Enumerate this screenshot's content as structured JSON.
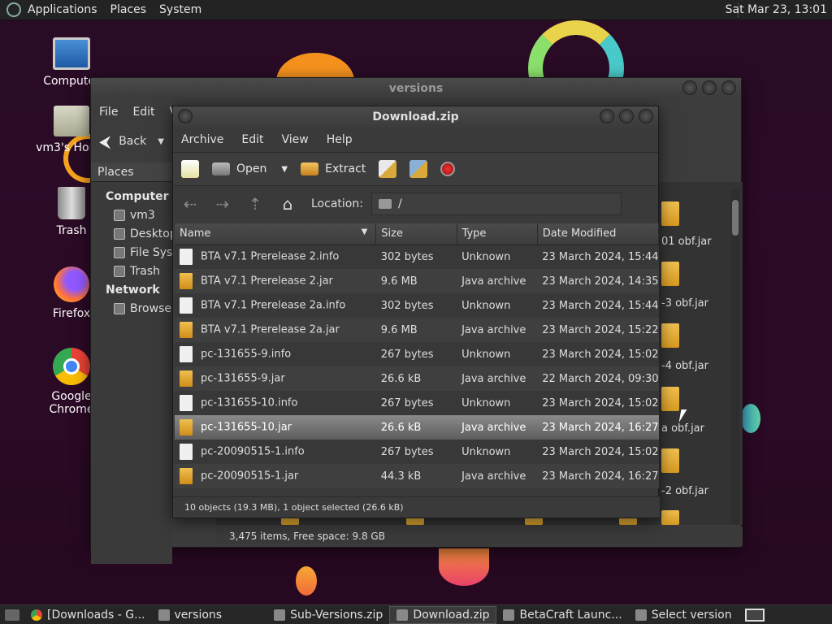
{
  "top_panel": {
    "menus": [
      "Applications",
      "Places",
      "System"
    ],
    "clock": "Sat Mar 23, 13:01"
  },
  "desktop_icons": [
    {
      "label": "Computer"
    },
    {
      "label": "vm3's Home"
    },
    {
      "label": "Trash"
    },
    {
      "label": "Firefox"
    },
    {
      "label": "Google Chrome"
    }
  ],
  "versions_window": {
    "title": "versions",
    "menu": [
      "File",
      "Edit",
      "V"
    ],
    "back_label": "Back",
    "places_label": "Places",
    "sections": {
      "computer": "Computer",
      "network": "Network"
    },
    "computer_items": [
      "vm3",
      "Desktop",
      "File System",
      "Trash"
    ],
    "network_items": [
      "Browse Network"
    ],
    "files": [
      "01 obf.jar",
      "-3 obf.jar",
      "-4 obf.jar",
      "a obf.jar",
      "-2 obf.jar"
    ],
    "status": "3,475 items, Free space: 9.8 GB"
  },
  "download_window": {
    "title": "Download.zip",
    "menu": [
      "Archive",
      "Edit",
      "View",
      "Help"
    ],
    "toolbar": {
      "open": "Open",
      "extract": "Extract"
    },
    "location_label": "Location:",
    "location_path": "/",
    "columns": [
      "Name",
      "Size",
      "Type",
      "Date Modified"
    ],
    "rows": [
      {
        "name": "BTA v7.1 Prerelease 2.info",
        "size": "302 bytes",
        "type": "Unknown",
        "date": "23 March 2024, 15:44",
        "kind": "info"
      },
      {
        "name": "BTA v7.1 Prerelease 2.jar",
        "size": "9.6 MB",
        "type": "Java archive",
        "date": "23 March 2024, 14:35",
        "kind": "jar"
      },
      {
        "name": "BTA v7.1 Prerelease 2a.info",
        "size": "302 bytes",
        "type": "Unknown",
        "date": "23 March 2024, 15:44",
        "kind": "info"
      },
      {
        "name": "BTA v7.1 Prerelease 2a.jar",
        "size": "9.6 MB",
        "type": "Java archive",
        "date": "23 March 2024, 15:22",
        "kind": "jar"
      },
      {
        "name": "pc-131655-9.info",
        "size": "267 bytes",
        "type": "Unknown",
        "date": "23 March 2024, 15:02",
        "kind": "info"
      },
      {
        "name": "pc-131655-9.jar",
        "size": "26.6 kB",
        "type": "Java archive",
        "date": "22 March 2024, 09:30",
        "kind": "jar"
      },
      {
        "name": "pc-131655-10.info",
        "size": "267 bytes",
        "type": "Unknown",
        "date": "23 March 2024, 15:02",
        "kind": "info"
      },
      {
        "name": "pc-131655-10.jar",
        "size": "26.6 kB",
        "type": "Java archive",
        "date": "23 March 2024, 16:27",
        "kind": "jar",
        "selected": true
      },
      {
        "name": "pc-20090515-1.info",
        "size": "267 bytes",
        "type": "Unknown",
        "date": "23 March 2024, 15:02",
        "kind": "info"
      },
      {
        "name": "pc-20090515-1.jar",
        "size": "44.3 kB",
        "type": "Java archive",
        "date": "23 March 2024, 16:27",
        "kind": "jar"
      }
    ],
    "status": "10 objects (19.3 MB), 1 object selected (26.6 kB)"
  },
  "taskbar": {
    "tasks": [
      {
        "label": "[Downloads - G..."
      },
      {
        "label": "versions"
      },
      {
        "label": "Sub-Versions.zip"
      },
      {
        "label": "Download.zip",
        "active": true
      },
      {
        "label": "BetaCraft Launc..."
      },
      {
        "label": "Select version"
      }
    ]
  },
  "colors": {
    "desktop_bg": "#2a0b26",
    "accent_orange": "#f39c2b",
    "accent_green": "#7bd96a",
    "selected_row": "#707070"
  }
}
